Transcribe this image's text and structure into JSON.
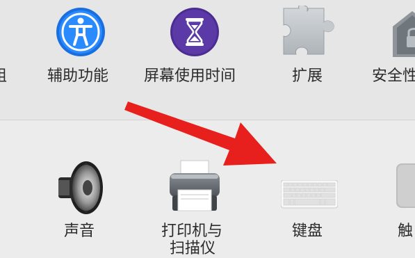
{
  "row1": {
    "items": [
      {
        "label": "组",
        "icon": "users-groups-icon"
      },
      {
        "label": "辅助功能",
        "icon": "accessibility-icon"
      },
      {
        "label": "屏幕使用时间",
        "icon": "screen-time-icon"
      },
      {
        "label": "扩展",
        "icon": "extensions-icon"
      },
      {
        "label": "安全性",
        "icon": "security-icon"
      }
    ]
  },
  "row2": {
    "items": [
      {
        "label": "声音",
        "icon": "sound-icon"
      },
      {
        "label": "打印机与",
        "label2": "扫描仪",
        "icon": "printer-icon"
      },
      {
        "label": "键盘",
        "icon": "keyboard-icon"
      },
      {
        "label": "触",
        "icon": "trackpad-icon"
      }
    ]
  },
  "annotation": {
    "color": "#e8201d",
    "icon": "red-arrow-icon"
  }
}
